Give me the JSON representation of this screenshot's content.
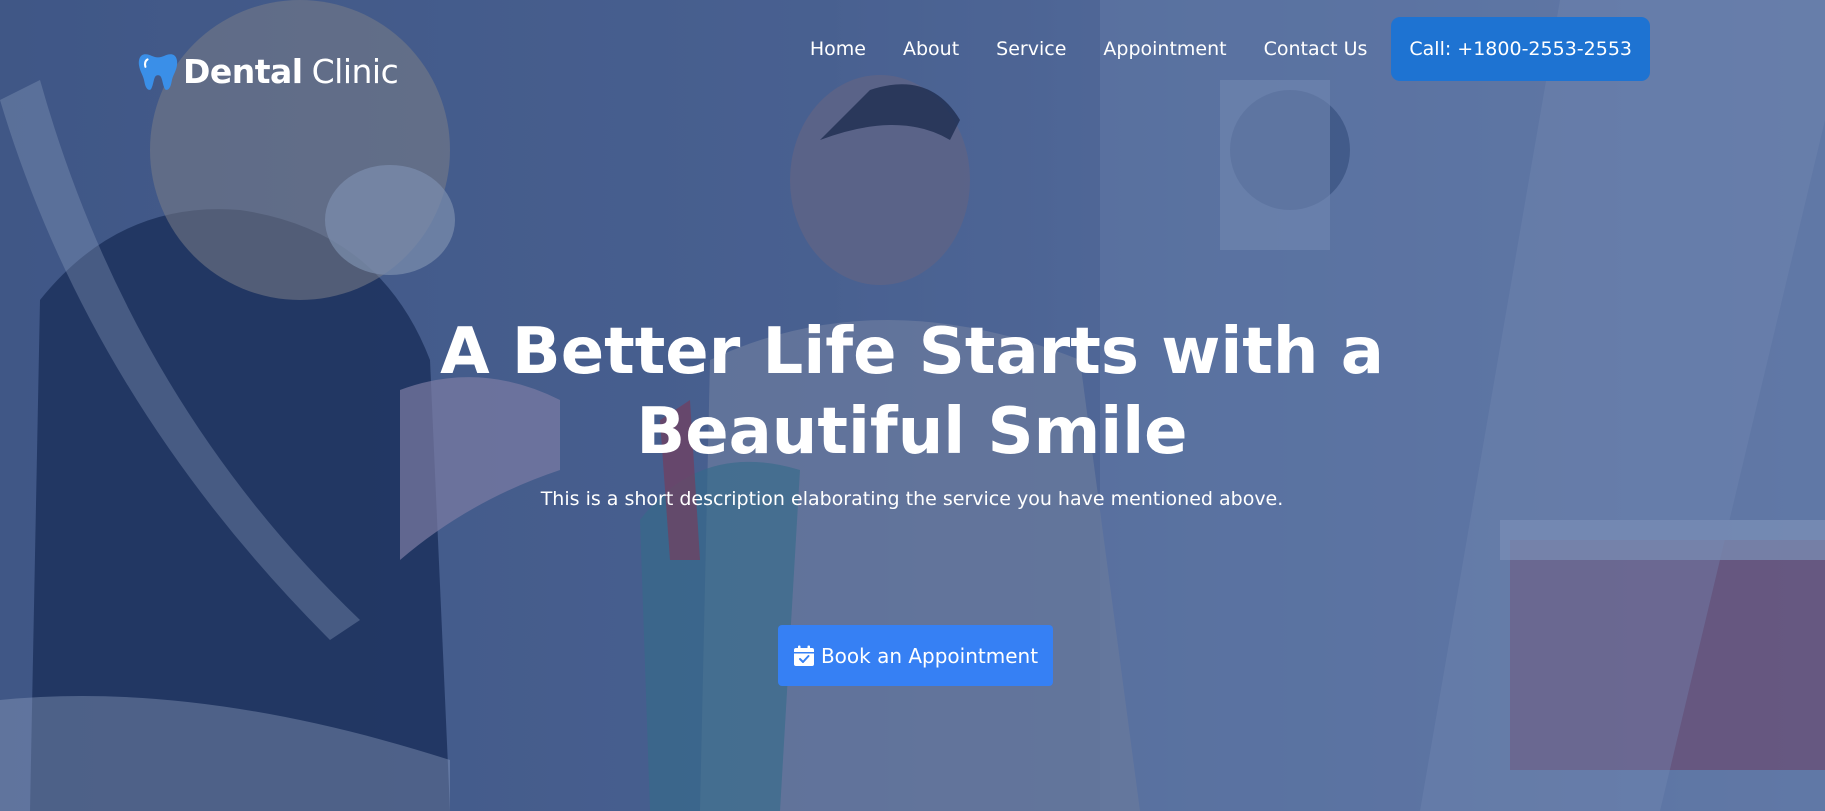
{
  "logo": {
    "icon": "tooth-icon",
    "brand_bold": "Dental",
    "brand_light": "Clinic"
  },
  "nav": {
    "items": [
      {
        "label": "Home"
      },
      {
        "label": "About"
      },
      {
        "label": "Service"
      },
      {
        "label": "Appointment"
      },
      {
        "label": "Contact Us"
      }
    ],
    "call_label": "Call: +1800-2553-2553"
  },
  "hero": {
    "headline_line1": "A Better Life Starts with a",
    "headline_line2": "Beautiful Smile",
    "description": "This is a short description elaborating the service you have mentioned above.",
    "cta_label": "Book an Appointment",
    "cta_icon": "calendar-check-icon"
  },
  "colors": {
    "accent": "#1e73d2",
    "cta": "#3680f4",
    "overlay": "#2f4f8a"
  }
}
